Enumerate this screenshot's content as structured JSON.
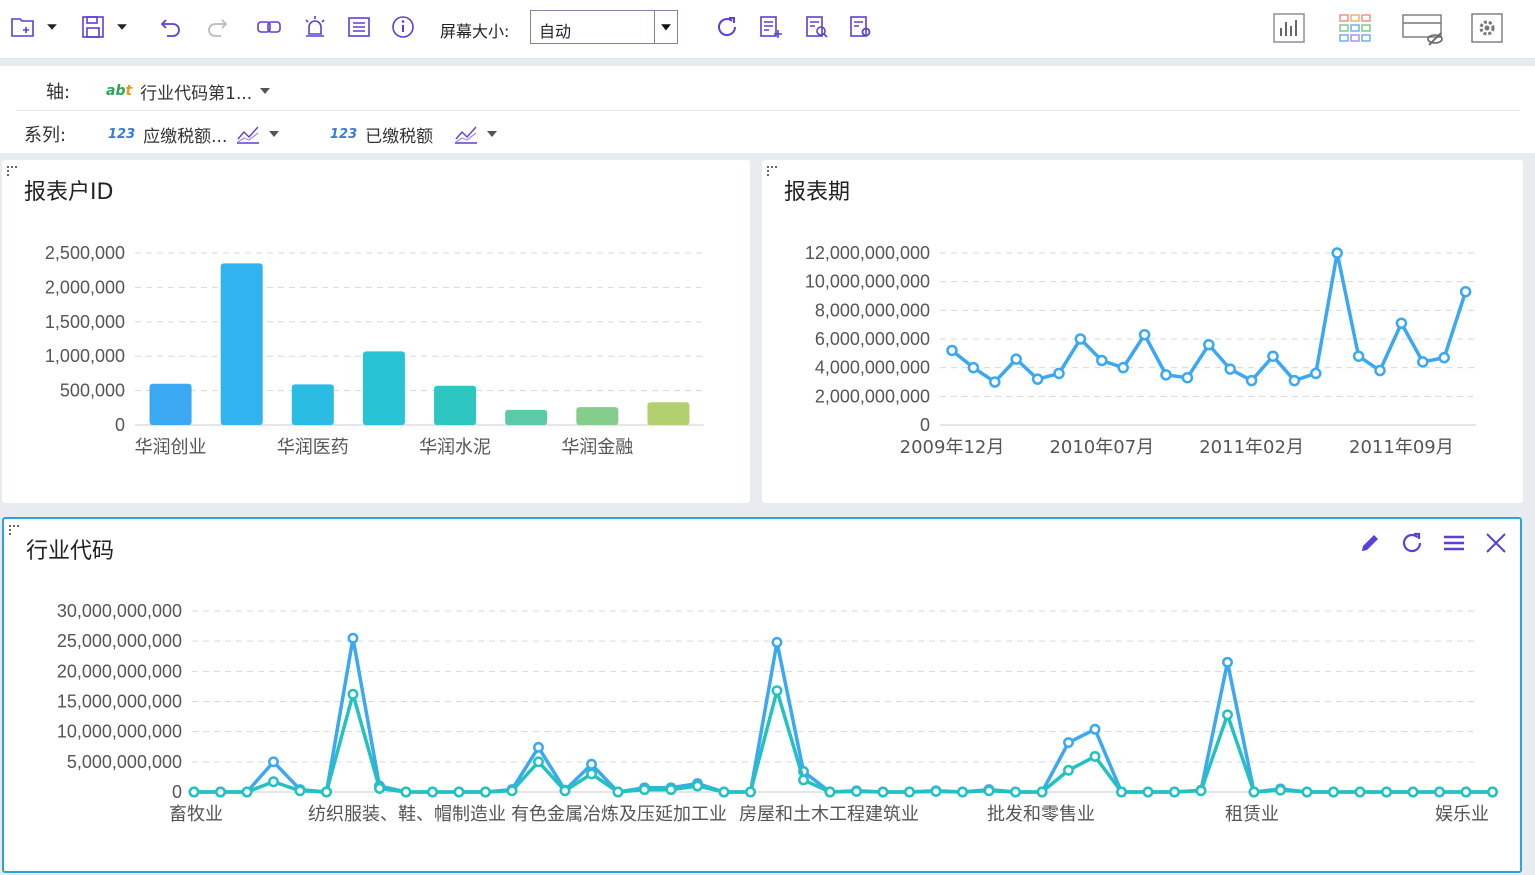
{
  "toolbar": {
    "screen_size_label": "屏幕大小:",
    "screen_size_value": "自动"
  },
  "config": {
    "axis_label": "轴:",
    "axis_field": "行业代码第1...",
    "series_label": "系列:",
    "series_fields": [
      "应缴税额...",
      "已缴税额"
    ]
  },
  "panels": {
    "p1_title": "报表户ID",
    "p2_title": "报表期",
    "p3_title": "行业代码"
  },
  "chart_data": [
    {
      "type": "bar",
      "title": "报表户ID",
      "categories": [
        "华润创业",
        "",
        "华润医药",
        "",
        "华润水泥",
        "",
        "华润金融",
        ""
      ],
      "values": [
        600000,
        2350000,
        590000,
        1070000,
        570000,
        220000,
        260000,
        330000
      ],
      "colors": [
        "#3aa8f2",
        "#30b3ee",
        "#2bbce4",
        "#27c4d6",
        "#2dc6c0",
        "#5cc9a7",
        "#85cd8c",
        "#b2d06f"
      ],
      "yticks": [
        "0",
        "500,000",
        "1,000,000",
        "1,500,000",
        "2,000,000",
        "2,500,000"
      ],
      "ylim": [
        0,
        2500000
      ]
    },
    {
      "type": "line",
      "title": "报表期",
      "xticks": [
        "2009年12月",
        "2010年07月",
        "2011年02月",
        "2011年09月"
      ],
      "values": [
        5.2,
        4.0,
        3.0,
        4.6,
        3.2,
        3.6,
        6.0,
        4.5,
        4.0,
        6.3,
        3.5,
        3.3,
        5.6,
        3.9,
        3.1,
        4.8,
        3.1,
        3.6,
        12.0,
        4.8,
        3.8,
        7.1,
        4.4,
        4.7,
        9.3
      ],
      "unit_multiplier": 1000000000,
      "yticks": [
        "0",
        "2,000,000,000",
        "4,000,000,000",
        "6,000,000,000",
        "8,000,000,000",
        "10,000,000,000",
        "12,000,000,000"
      ],
      "ylim": [
        0,
        12000000000
      ],
      "colors": [
        "#3aa8f2"
      ]
    },
    {
      "type": "line",
      "title": "行业代码",
      "xticks": [
        "畜牧业",
        "纺织服装、鞋、帽制造业",
        "有色金属冶炼及压延加工业",
        "房屋和土木工程建筑业",
        "批发和零售业",
        "租赁业",
        "娱乐业"
      ],
      "unit_multiplier": 1000000000,
      "yticks": [
        "0",
        "5,000,000,000",
        "10,000,000,000",
        "15,000,000,000",
        "20,000,000,000",
        "25,000,000,000",
        "30,000,000,000"
      ],
      "ylim": [
        0,
        30000000000
      ],
      "series": [
        {
          "name": "应缴税额...",
          "color": "#3aa8f2",
          "values": [
            0,
            0,
            0,
            5.0,
            0.4,
            0,
            25.5,
            1.0,
            0,
            0,
            0,
            0,
            0.4,
            7.4,
            0.3,
            4.6,
            0,
            0.7,
            0.7,
            1.4,
            0,
            0,
            24.8,
            3.4,
            0,
            0.2,
            0,
            0,
            0.2,
            0,
            0.4,
            0,
            0,
            8.2,
            10.4,
            0,
            0,
            0,
            0.3,
            21.5,
            0,
            0.5,
            0,
            0,
            0,
            0,
            0,
            0,
            0,
            0
          ]
        },
        {
          "name": "已缴税额",
          "color": "#24c1c1",
          "values": [
            0,
            0,
            0,
            1.7,
            0.2,
            0,
            16.2,
            0.6,
            0,
            0,
            0,
            0,
            0.2,
            5.0,
            0.2,
            3.0,
            0,
            0.4,
            0.4,
            1.0,
            0,
            0,
            16.8,
            2.0,
            0,
            0.1,
            0,
            0,
            0.1,
            0,
            0.2,
            0,
            0,
            3.6,
            5.9,
            0,
            0,
            0,
            0.2,
            12.8,
            0,
            0.3,
            0,
            0,
            0,
            0,
            0,
            0,
            0,
            0
          ]
        }
      ]
    }
  ]
}
